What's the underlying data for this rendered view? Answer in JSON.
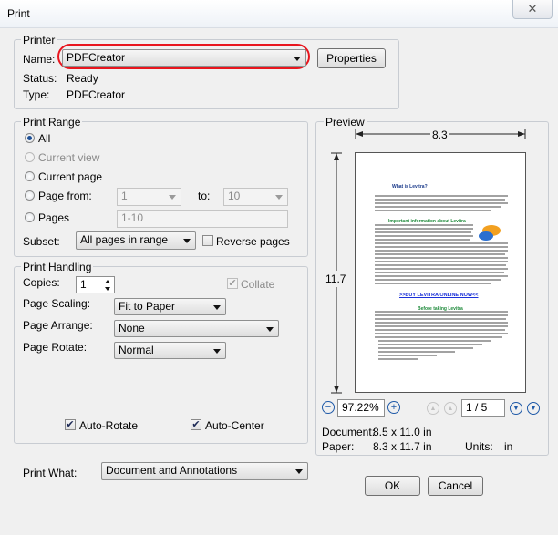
{
  "window": {
    "title": "Print",
    "close_glyph": "✕"
  },
  "printer": {
    "group_label": "Printer",
    "name_label": "Name:",
    "name_value": "PDFCreator",
    "properties_label": "Properties",
    "status_label": "Status:",
    "status_value": "Ready",
    "type_label": "Type:",
    "type_value": "PDFCreator"
  },
  "print_range": {
    "group_label": "Print Range",
    "all_label": "All",
    "current_view_label": "Current view",
    "current_page_label": "Current page",
    "page_from_label": "Page from:",
    "page_from_value": "1",
    "to_label": "to:",
    "page_to_value": "10",
    "pages_label": "Pages",
    "pages_value": "1-10",
    "subset_label": "Subset:",
    "subset_value": "All pages in range",
    "reverse_label": "Reverse pages",
    "selected": "All"
  },
  "handling": {
    "group_label": "Print Handling",
    "copies_label": "Copies:",
    "copies_value": "1",
    "collate_label": "Collate",
    "page_scaling_label": "Page Scaling:",
    "page_scaling_value": "Fit to Paper",
    "page_arrange_label": "Page Arrange:",
    "page_arrange_value": "None",
    "page_rotate_label": "Page Rotate:",
    "page_rotate_value": "Normal",
    "auto_rotate_label": "Auto-Rotate",
    "auto_rotate_checked": true,
    "auto_center_label": "Auto-Center",
    "auto_center_checked": true,
    "check_glyph": "✔"
  },
  "print_what": {
    "label": "Print What:",
    "value": "Document and Annotations"
  },
  "preview": {
    "group_label": "Preview",
    "width_dim": "8.3",
    "height_dim": "11.7",
    "zoom_value": "97.22%",
    "page_value": "1 / 5",
    "zoom_out_glyph": "−",
    "zoom_in_glyph": "+",
    "first_glyph": "▲",
    "prev_glyph": "▲",
    "next_glyph": "▼",
    "last_glyph": "▼",
    "document_label": "Document:",
    "document_value": "8.5 x 11.0 in",
    "paper_label": "Paper:",
    "paper_value": "8.3 x 11.7 in",
    "units_label": "Units:",
    "units_value": "in",
    "page_heading": "What is Levitra?",
    "page_subheading": "Important information about Levitra",
    "page_link": ">>BUY LEVITRA ONLINE NOW<<",
    "page_section": "Before taking Levitra"
  },
  "buttons": {
    "ok": "OK",
    "cancel": "Cancel"
  }
}
